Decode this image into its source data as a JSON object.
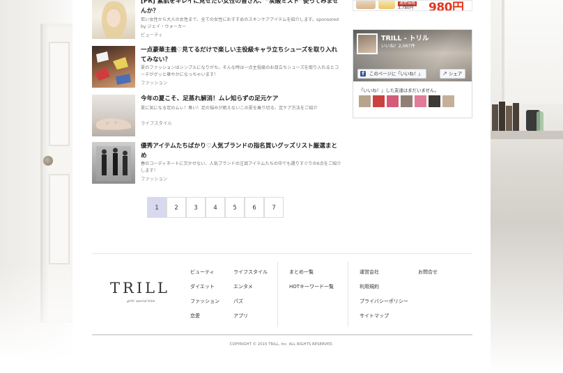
{
  "articles": [
    {
      "title": "[PR] 素肌をキレイに見せたい女性の皆さん、“炭酸ミスト”使ってみませんか？",
      "desc": "若い女性から大人の女性まで、全ての女性におすすめのスキンケアアイテムを紹介します。sponsored by ジェイ・ウォーカー",
      "category": "ビューティ"
    },
    {
      "title": "一点豪華主義♡見てるだけで楽しい主役級キャラ立ちシューズを取り入れてみない？",
      "desc": "夏のファッションはシンプルになりがち。そんな時は一点主役級のお目立ちシューズを取り入れるとコーデがグッと華やかになっちゃいます！",
      "category": "ファッション"
    },
    {
      "title": "今年の夏こそ、足蒸れ解消！ムレ知らずの足元ケア",
      "desc": "夏に気になる足のムレ！臭い！足の悩みが絶えないこの夏を乗り切る、足ケア方法をご紹介",
      "category": "ライフスタイル"
    },
    {
      "title": "優秀アイテムたちばかり♡人気ブランドの指名買いグッズリスト厳選まとめ",
      "desc": "春のコーディネートに欠かせない、人気ブランドの注目アイテムたちの中でも選りすぐりの6点をご紹介します！",
      "category": "ファッション"
    }
  ],
  "ad": {
    "normal_label": "通常価格",
    "normal_price": "3,780円",
    "price": "980円"
  },
  "facebook": {
    "page_name": "TRILL - トリル",
    "likes": "いいね！2,067件",
    "like_button": "このページに「いいね！」",
    "share_button": "シェア",
    "friends_text": "「いいね！」した友達はまだいません。"
  },
  "pagination": [
    "1",
    "2",
    "3",
    "4",
    "5",
    "6",
    "7"
  ],
  "footer": {
    "logo": "TRILL",
    "logo_sub": "girls' special time",
    "col1": [
      "ビューティ",
      "ダイエット",
      "ファッション",
      "恋愛"
    ],
    "col2": [
      "ライフスタイル",
      "エンタメ",
      "パズ",
      "アプリ"
    ],
    "col3": [
      "まとめ一覧",
      "HOTキーワード一覧"
    ],
    "col4": [
      "運営会社",
      "利用規約",
      "プライバシーポリシー",
      "サイトマップ"
    ],
    "col5": [
      "お問合せ"
    ],
    "copyright": "COPYRIGHT © 2015 TRILL, Inc. ALL RIGHTS RESERVED."
  },
  "colors": {
    "accent_price": "#e4371f",
    "active_page": "#d8d8ee",
    "facebook_blue": "#3b5998"
  }
}
